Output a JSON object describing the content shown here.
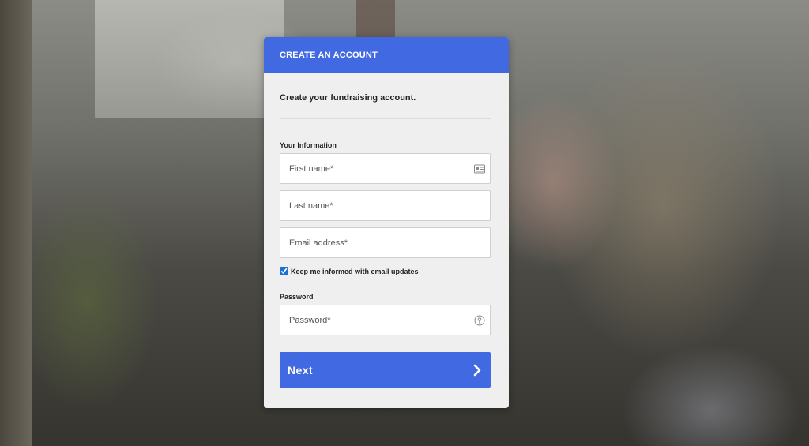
{
  "header": {
    "title": "CREATE AN ACCOUNT"
  },
  "form": {
    "subtitle": "Create your fundraising account.",
    "section_info": "Your Information",
    "first_name": {
      "placeholder": "First name*",
      "icon": "id-card-icon"
    },
    "last_name": {
      "placeholder": "Last name*"
    },
    "email": {
      "placeholder": "Email address*"
    },
    "email_updates": {
      "label": "Keep me informed with email updates",
      "checked": true
    },
    "section_password": "Password",
    "password": {
      "placeholder": "Password*",
      "icon": "password-manager-icon"
    },
    "next_label": "Next"
  },
  "colors": {
    "accent": "#4169e1",
    "card_bg": "#efefef"
  }
}
